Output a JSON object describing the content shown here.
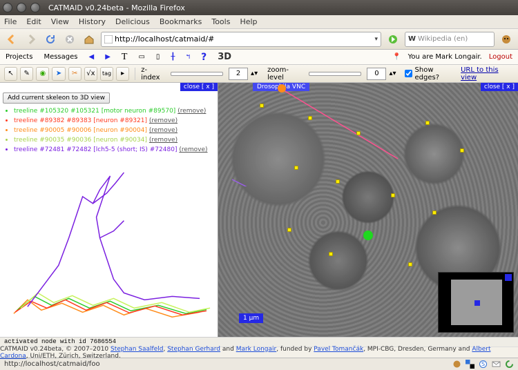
{
  "window": {
    "title": "CATMAID v0.24beta - Mozilla Firefox"
  },
  "menu": [
    "File",
    "Edit",
    "View",
    "History",
    "Delicious",
    "Bookmarks",
    "Tools",
    "Help"
  ],
  "url": "http://localhost/catmaid/#",
  "wikipedia_placeholder": "Wikipedia (en)",
  "appbar": {
    "projects": "Projects",
    "messages": "Messages",
    "text_tool": "T",
    "td": "3D",
    "user_msg": "You are Mark Longair.",
    "logout": "Logout"
  },
  "toolbar": {
    "tag": "tag",
    "zindex_label": "z-index",
    "zindex_val": "2",
    "zoom_label": "zoom-level",
    "zoom_val": "0",
    "show_edges": "Show edges?",
    "url_link": "URL to this view"
  },
  "left": {
    "close": "close [ x ]",
    "add_btn": "Add current skeleon to 3D view",
    "trees": [
      {
        "color": "#2bcc2b",
        "text": "treeline #105320 #105321 [motor neuron #89570]",
        "remove": "(remove)"
      },
      {
        "color": "#ff3a1f",
        "text": "treeline #89382 #89383 [neuron #89321]",
        "remove": "(remove)"
      },
      {
        "color": "#ff8c1a",
        "text": "treeline #90005 #90006 [neuron #90004]",
        "remove": "(remove)"
      },
      {
        "color": "#c7f25c",
        "text": "treeline #90035 #90036 [neuron #90034]",
        "remove": "(remove)"
      },
      {
        "color": "#7a1fe0",
        "text": "treeline #72481 #72482 [lch5-5 (short; IS) #72480]",
        "remove": "(remove)"
      }
    ]
  },
  "right": {
    "close": "close [ x ]",
    "dataset": "Drosophila VNC",
    "scale": "1 µm"
  },
  "status": "activated node with id 7686554",
  "footer": {
    "prefix": "CATMAID v0.24beta, © 2007–2010 ",
    "a1": "Stephan Saalfeld",
    "c1": ", ",
    "a2": "Stephan Gerhard",
    "c2": " and ",
    "a3": "Mark Longair",
    "mid": ", funded by ",
    "a4": "Pavel Tomančák",
    "c4": ", MPI-CBG, Dresden, Germany and ",
    "a5": "Albert Cardona",
    "suffix": ", Uni/ETH, Zürich, Switzerland."
  },
  "bstatus": "http://localhost/catmaid/foo"
}
